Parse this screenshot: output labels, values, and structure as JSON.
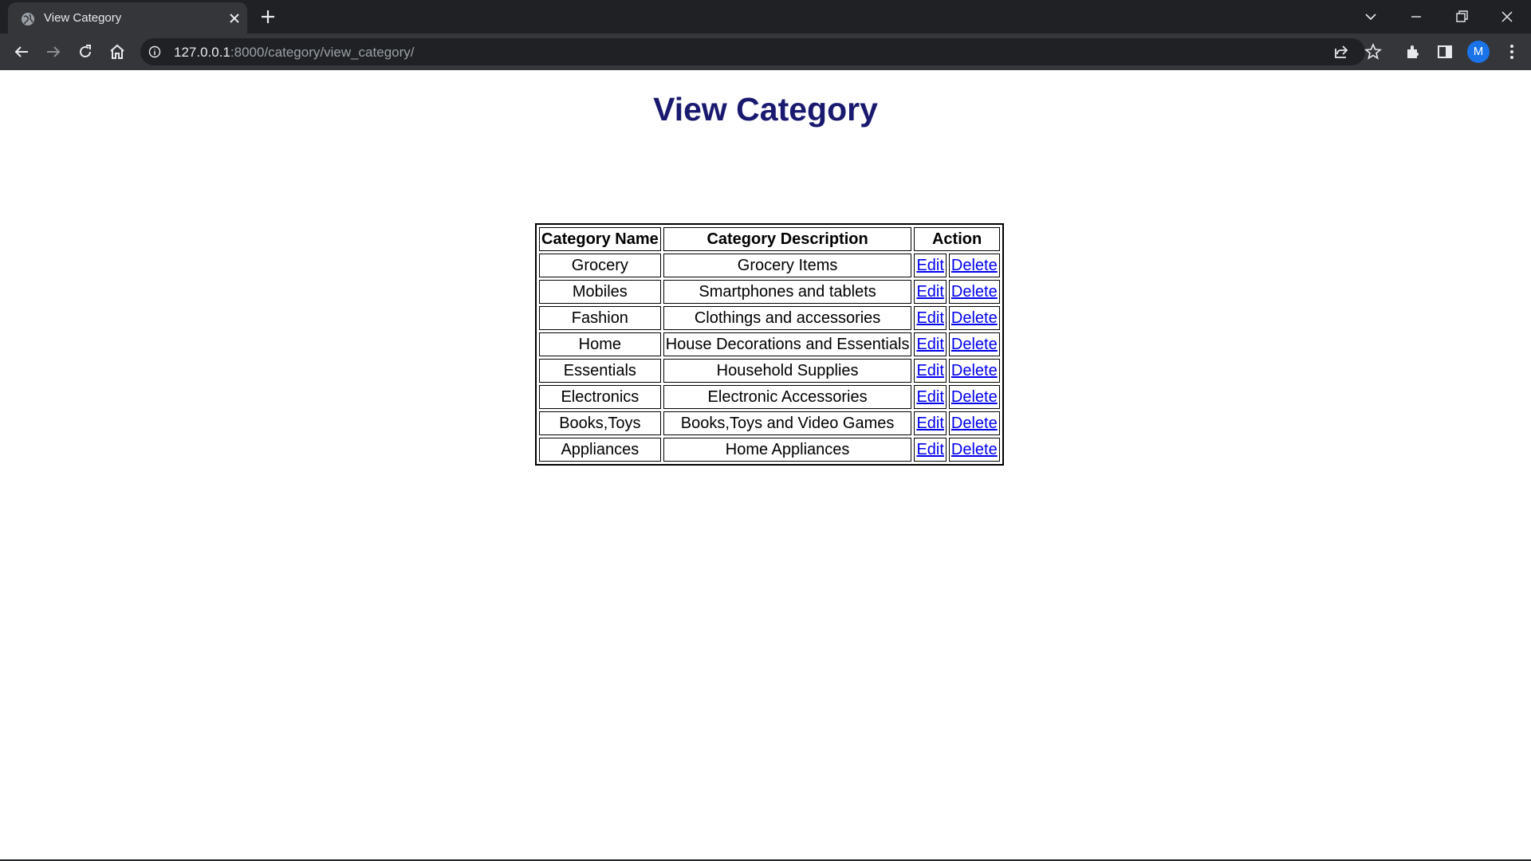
{
  "browser": {
    "tab_title": "View Category",
    "url_host": "127.0.0.1",
    "url_path": ":8000/category/view_category/",
    "avatar_letter": "M",
    "accent_color": "#1a73e8"
  },
  "page": {
    "title": "View Category",
    "title_color": "#191970",
    "headers": [
      "Category Name",
      "Category Description",
      "Action"
    ],
    "edit_label": "Edit",
    "delete_label": "Delete",
    "rows": [
      {
        "name": "Grocery",
        "description": "Grocery Items"
      },
      {
        "name": "Mobiles",
        "description": "Smartphones and tablets"
      },
      {
        "name": "Fashion",
        "description": "Clothings and accessories"
      },
      {
        "name": "Home",
        "description": "House Decorations and Essentials"
      },
      {
        "name": "Essentials",
        "description": "Household Supplies"
      },
      {
        "name": "Electronics",
        "description": "Electronic Accessories"
      },
      {
        "name": "Books,Toys",
        "description": "Books,Toys and Video Games"
      },
      {
        "name": "Appliances",
        "description": "Home Appliances"
      }
    ]
  }
}
